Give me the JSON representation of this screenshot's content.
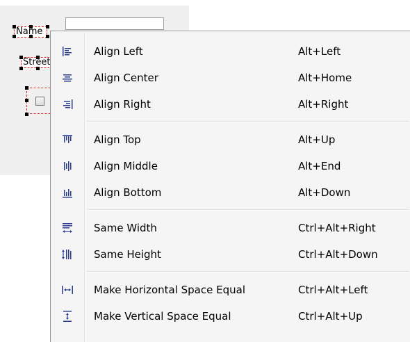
{
  "designer": {
    "label_name": "Name",
    "label_street": "Street"
  },
  "menu": {
    "groups": [
      [
        {
          "label": "Align Left",
          "shortcut": "Alt+Left",
          "icon": "align-left-icon"
        },
        {
          "label": "Align Center",
          "shortcut": "Alt+Home",
          "icon": "align-center-icon"
        },
        {
          "label": "Align Right",
          "shortcut": "Alt+Right",
          "icon": "align-right-icon"
        }
      ],
      [
        {
          "label": "Align Top",
          "shortcut": "Alt+Up",
          "icon": "align-top-icon"
        },
        {
          "label": "Align Middle",
          "shortcut": "Alt+End",
          "icon": "align-middle-icon"
        },
        {
          "label": "Align Bottom",
          "shortcut": "Alt+Down",
          "icon": "align-bottom-icon"
        }
      ],
      [
        {
          "label": "Same Width",
          "shortcut": "Ctrl+Alt+Right",
          "icon": "same-width-icon"
        },
        {
          "label": "Same Height",
          "shortcut": "Ctrl+Alt+Down",
          "icon": "same-height-icon"
        }
      ],
      [
        {
          "label": "Make Horizontal Space Equal",
          "shortcut": "Ctrl+Alt+Left",
          "icon": "horizontal-space-icon"
        },
        {
          "label": "Make Vertical Space Equal",
          "shortcut": "Ctrl+Alt+Up",
          "icon": "vertical-space-icon"
        }
      ]
    ],
    "colors": {
      "icon": "#2a3c8f",
      "background": "#f5f5f5"
    }
  }
}
